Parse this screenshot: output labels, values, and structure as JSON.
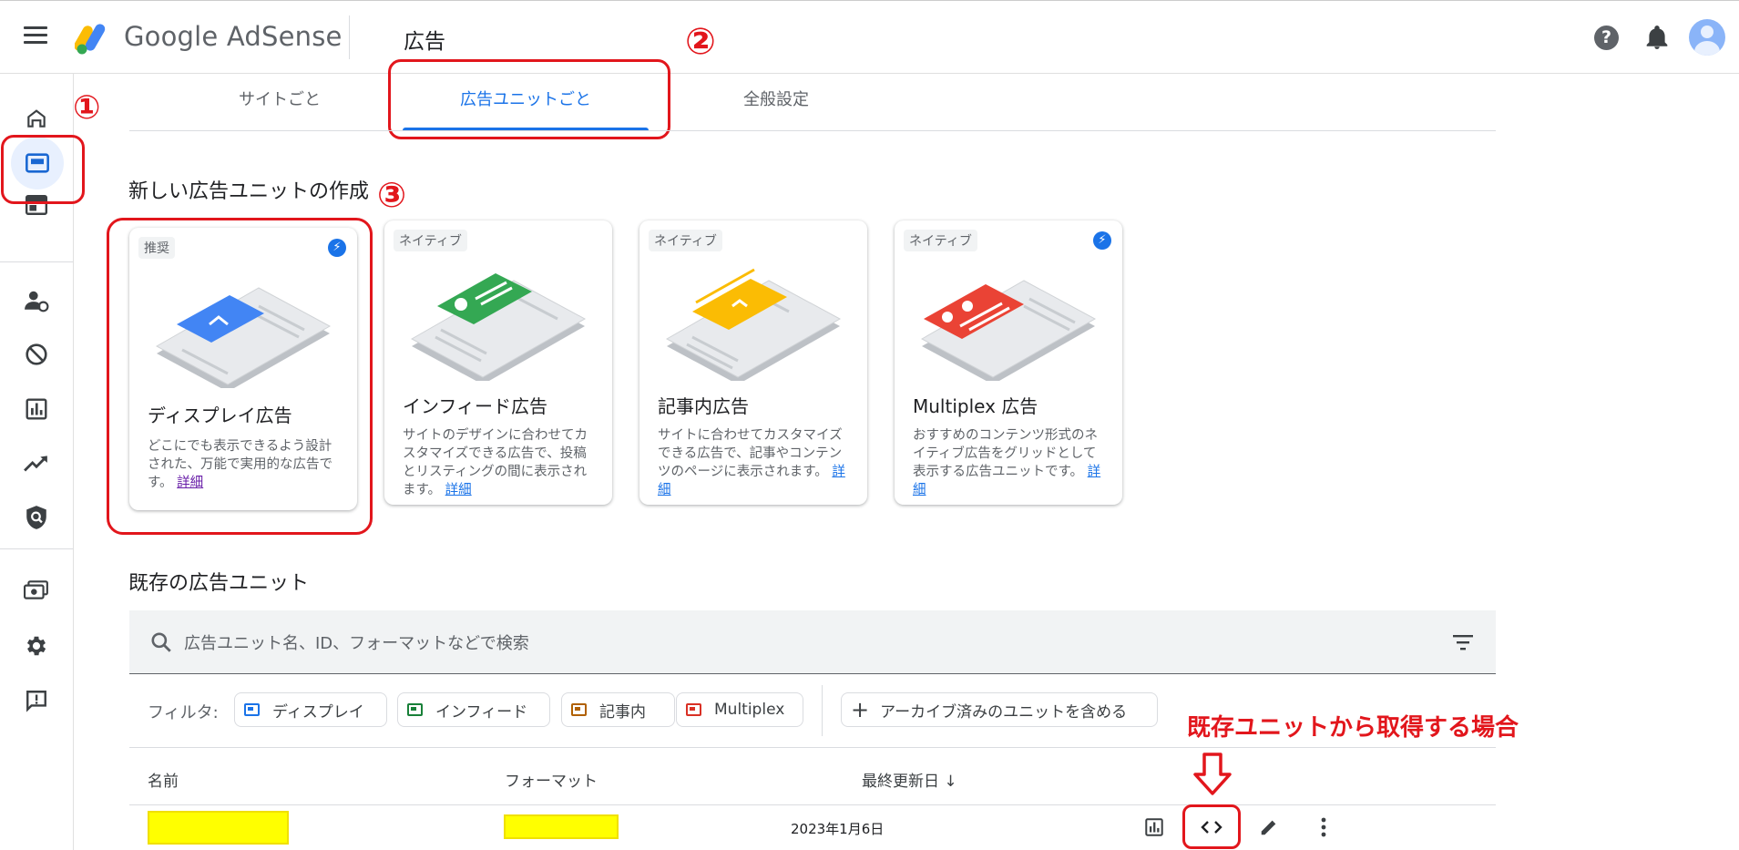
{
  "header": {
    "brand": "Google AdSense",
    "page_title": "広告"
  },
  "tabs": [
    {
      "label": "サイトごと",
      "active": false
    },
    {
      "label": "広告ユニットごと",
      "active": true
    },
    {
      "label": "全般設定",
      "active": false
    }
  ],
  "create_section": {
    "title": "新しい広告ユニットの作成",
    "cards": [
      {
        "badge": "推奨",
        "title": "ディスプレイ広告",
        "desc": "どこにでも表示できるよう設計された、万能で実用的な広告です。",
        "link": "詳細",
        "accent": "#4285f4",
        "bolt": true
      },
      {
        "badge": "ネイティブ",
        "title": "インフィード広告",
        "desc": "サイトのデザインに合わせてカスタマイズできる広告で、投稿とリスティングの間に表示されます。",
        "link": "詳細",
        "accent": "#34a853",
        "bolt": false
      },
      {
        "badge": "ネイティブ",
        "title": "記事内広告",
        "desc": "サイトに合わせてカスタマイズできる広告で、記事やコンテンツのページに表示されます。",
        "link": "詳細",
        "accent": "#fbbc04",
        "bolt": false
      },
      {
        "badge": "ネイティブ",
        "title": "Multiplex 広告",
        "desc": "おすすめのコンテンツ形式のネイティブ広告をグリッドとして表示する広告ユニットです。",
        "link": "詳細",
        "accent": "#ea4335",
        "bolt": true
      }
    ]
  },
  "existing_section": {
    "title": "既存の広告ユニット",
    "search_placeholder": "広告ユニット名、ID、フォーマットなどで検索",
    "filter_label": "フィルタ:",
    "chips": [
      {
        "label": "ディスプレイ",
        "color": "#1a73e8"
      },
      {
        "label": "インフィード",
        "color": "#188038"
      },
      {
        "label": "記事内",
        "color": "#b06000"
      },
      {
        "label": "Multiplex",
        "color": "#d93025"
      }
    ],
    "archive_chip": "アーカイブ済みのユニットを含める",
    "columns": {
      "name": "名前",
      "format": "フォーマット",
      "updated": "最終更新日 ↓"
    },
    "rows": [
      {
        "date": "2023年1月6日"
      }
    ]
  },
  "annotations": {
    "step1": "①",
    "step2": "②",
    "step3": "③",
    "note": "既存ユニットから取得する場合",
    "accent": "#e2161c"
  }
}
